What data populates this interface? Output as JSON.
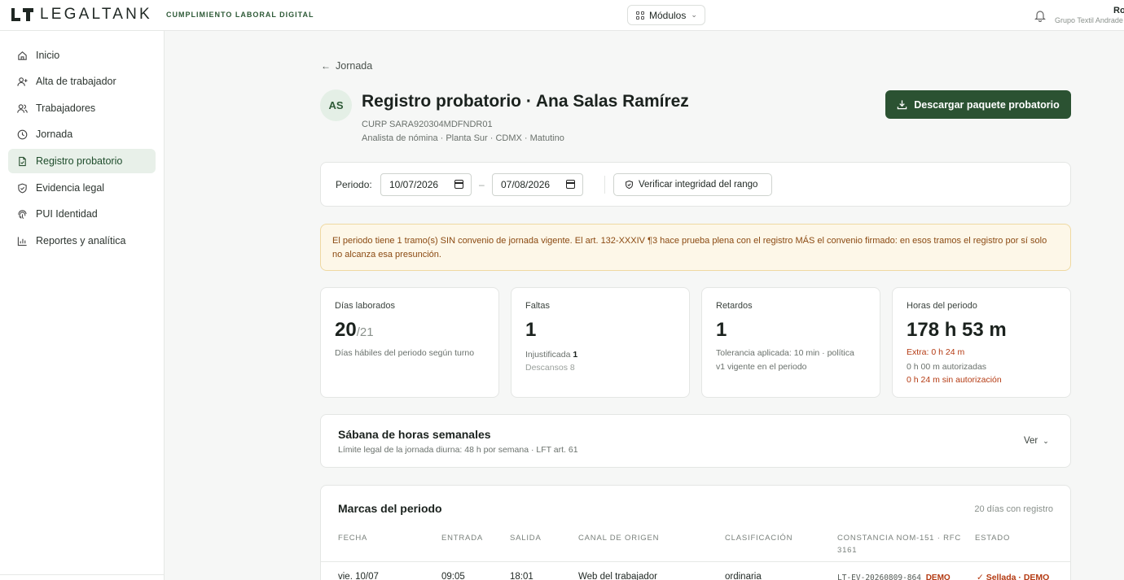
{
  "header": {
    "brand": "LEGALTANK",
    "tagline": "CUMPLIMIENTO LABORAL DIGITAL",
    "modules_label": "Módulos",
    "user_name": "Ro",
    "user_org": "Grupo Textil Andrade"
  },
  "sidebar": {
    "items": [
      {
        "label": "Inicio",
        "icon": "home-icon"
      },
      {
        "label": "Alta de trabajador",
        "icon": "user-plus-icon"
      },
      {
        "label": "Trabajadores",
        "icon": "users-icon"
      },
      {
        "label": "Jornada",
        "icon": "clock-icon"
      },
      {
        "label": "Registro probatorio",
        "icon": "file-check-icon",
        "active": true
      },
      {
        "label": "Evidencia legal",
        "icon": "shield-check-icon"
      },
      {
        "label": "PUI Identidad",
        "icon": "fingerprint-icon"
      },
      {
        "label": "Reportes y analítica",
        "icon": "bar-chart-icon"
      }
    ]
  },
  "page": {
    "back_label": "Jornada",
    "avatar_initials": "AS",
    "title": "Registro probatorio · Ana Salas Ramírez",
    "curp": "CURP SARA920304MDFNDR01",
    "role": "Analista de nómina · Planta Sur · CDMX · Matutino",
    "download_label": "Descargar paquete probatorio"
  },
  "period": {
    "label": "Periodo:",
    "from": "10/07/2026",
    "to": "07/08/2026",
    "dash": "–",
    "verify_label": "Verificar integridad del rango"
  },
  "alert": {
    "text": "El periodo tiene 1 tramo(s) SIN convenio de jornada vigente. El art. 132-XXXIV ¶3 hace prueba plena con el registro MÁS el convenio firmado: en esos tramos el registro por sí solo no alcanza esa presunción."
  },
  "stats": {
    "dias": {
      "label": "Días laborados",
      "value": "20",
      "suffix": "/21",
      "note": "Días hábiles del periodo según turno"
    },
    "faltas": {
      "label": "Faltas",
      "value": "1",
      "injust_label": "Injustificada",
      "injust_value": "1",
      "descansos": "Descansos 8"
    },
    "retardos": {
      "label": "Retardos",
      "value": "1",
      "note1": "Tolerancia aplicada: 10 min · política",
      "note2": "v1 vigente en el periodo"
    },
    "horas": {
      "label": "Horas del periodo",
      "value": "178 h 53 m",
      "extra": "Extra: 0 h 24 m",
      "autorizadas": "0 h 00 m autorizadas",
      "sin_autorizacion": "0 h 24 m sin autorización"
    }
  },
  "sabana": {
    "title": "Sábana de horas semanales",
    "subtitle": "Límite legal de la jornada diurna: 48 h por semana · LFT art. 61",
    "toggle_label": "Ver"
  },
  "marcas": {
    "title": "Marcas del periodo",
    "count": "20 días con registro",
    "columns": [
      "FECHA",
      "ENTRADA",
      "SALIDA",
      "CANAL DE ORIGEN",
      "CLASIFICACIÓN",
      "CONSTANCIA NOM-151 · RFC 3161",
      "ESTADO"
    ],
    "rows": [
      {
        "fecha": "vie. 10/07",
        "entrada": "09:05",
        "salida": "18:01",
        "canal": "Web del trabajador",
        "clasificacion": "ordinaria",
        "constancia": "LT-EV-20260809-864",
        "constancia_tag": "DEMO",
        "estado": "✓ Sellada · DEMO"
      }
    ]
  },
  "colors": {
    "accent": "#2b5232",
    "alert_bg": "#fdf7e8",
    "alert_text": "#8b4a12",
    "warning_red": "#b43a12"
  }
}
